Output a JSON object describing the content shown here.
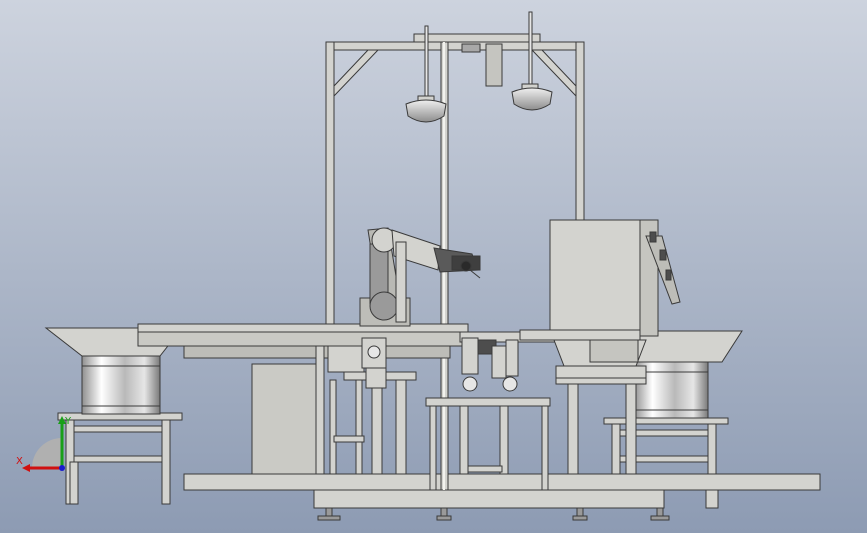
{
  "viewport": {
    "background_top": "#cdd3de",
    "background_bottom": "#8d9bb3",
    "part_fill": "#d3d3cf",
    "part_stroke": "#3a3a3a",
    "shadow_fill": "#b6b6b0",
    "dark_fill": "#4d4d4d"
  },
  "triad": {
    "x_label": "X",
    "y_label": "Y",
    "x_color": "#d01010",
    "y_color": "#18a018",
    "z_color": "#1a1ad0"
  }
}
